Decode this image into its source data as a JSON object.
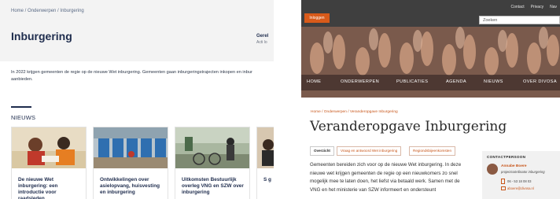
{
  "left_page": {
    "breadcrumb": [
      "Home",
      "Onderwerpen",
      "Inburgering"
    ],
    "breadcrumb_separator": " / ",
    "title": "Inburgering",
    "side_label": "Gerel",
    "side_sub": "Acti lo",
    "intro": "In 2022 krijgen gemeenten de regie op de nieuwe Wet inburgering. Gemeenten gaan inburgeringstrajecten inkopen en inbur aanbieden.",
    "news_heading": "NIEUWS",
    "news_cards": [
      {
        "title": "De nieuwe Wet inburgering: een introductie voor raadsleden"
      },
      {
        "title": "Ontwikkelingen over asielopvang, huisvesting en inburgering"
      },
      {
        "title": "Uitkomsten Bestuurlijk overleg VNG en SZW over inburgering"
      },
      {
        "title": "S g"
      }
    ]
  },
  "right_page": {
    "top_links": [
      "Contact",
      "Privacy",
      "Nav"
    ],
    "login_label": "Inloggen",
    "search_placeholder": "Zoeken",
    "nav": [
      "HOME",
      "ONDERWERPEN",
      "PUBLICATIES",
      "AGENDA",
      "NIEUWS",
      "OVER DIVOSA"
    ],
    "breadcrumb": "Home  /  Onderwerpen  /  Veranderopgave Inburgering",
    "title": "Veranderopgave Inburgering",
    "tabs": [
      "Overzicht",
      "Vraag en antwoord Wet inburgering",
      "Regiondsbijeenkomsten"
    ],
    "body": "Gemeenten bereiden zich voor op de nieuwe Wet inburgering. In deze nieuwe wet krijgen gemeenten de regie op een nieuwkomers zo snel mogelijk mee te laten doen, het liefst via betaald werk. Samen met de VNG en het ministerie van SZW informeert en ondersteunt",
    "contact": {
      "heading": "CONTACTPERSOON",
      "name": "Annabe Boere",
      "role": "projectcoördinator inburgering",
      "phone": "06 - 53 18 08 03",
      "email": "aboere@divosa.nl"
    }
  },
  "colors": {
    "accent": "#c8561a",
    "left_title": "#1e2c4d",
    "topbar": "#3f3f3f"
  }
}
